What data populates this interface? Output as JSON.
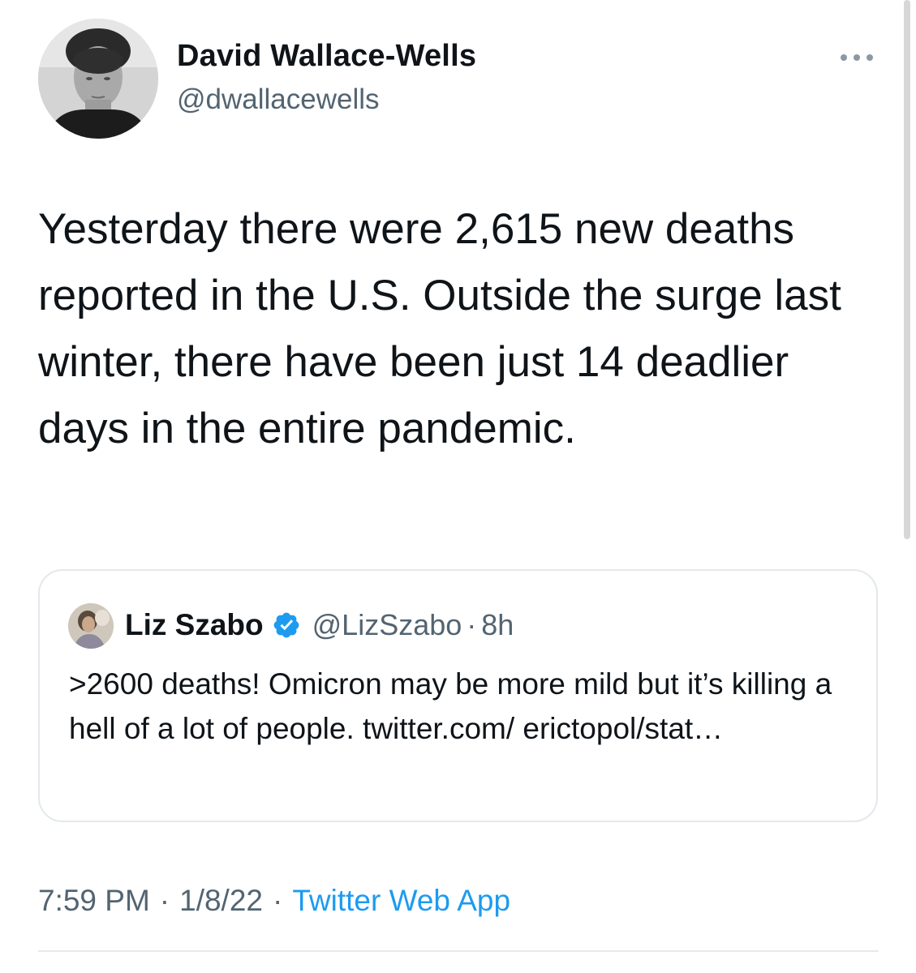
{
  "tweet": {
    "author": {
      "display_name": "David Wallace-Wells",
      "handle": "@dwallacewells",
      "avatar_icon": "author-avatar"
    },
    "more_icon": "more-horizontal-icon",
    "text": "Yesterday there were 2,615 new deaths reported in the U.S. Outside the surge last winter, there have been just 14 deadlier days in the entire pandemic.",
    "quoted": {
      "display_name": "Liz Szabo",
      "verified_icon": "verified-badge-icon",
      "handle": "@LizSzabo",
      "separator": "·",
      "time": "8h",
      "text": ">2600 deaths! Omicron may be more mild but it’s killing a hell of a lot of people. twitter.com/ erictopol/stat…"
    },
    "meta": {
      "time": "7:59 PM",
      "separator": "·",
      "date": "1/8/22",
      "source": "Twitter Web App"
    }
  },
  "colors": {
    "text_primary": "#0f1419",
    "text_secondary": "#536471",
    "link": "#1d9bf0",
    "verified": "#1d9bf0",
    "border": "#e3e8ec"
  }
}
